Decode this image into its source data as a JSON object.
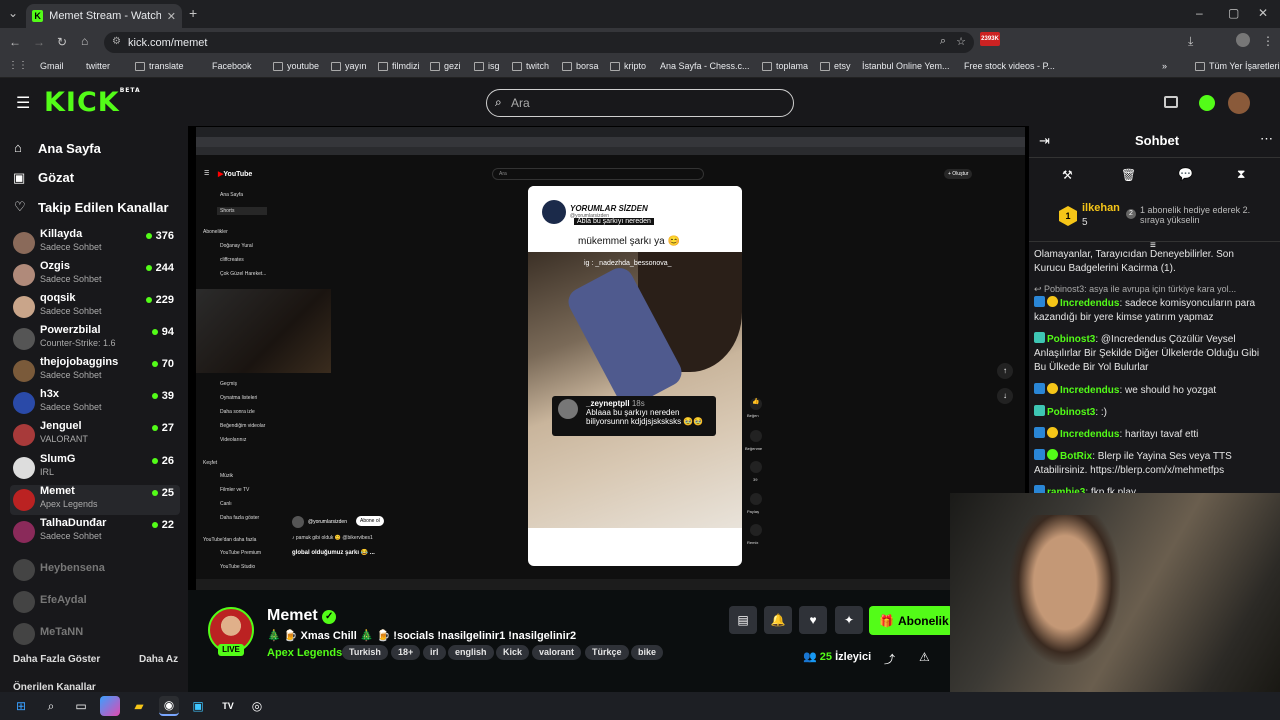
{
  "browser": {
    "tab_title": "Memet Stream - Watch Live on",
    "url": "kick.com/memet",
    "bookmarks": [
      "Gmail",
      "twitter",
      "translate",
      "Facebook",
      "youtube",
      "yayın",
      "filmdizi",
      "gezi",
      "isg",
      "twitch",
      "borsa",
      "kripto",
      "Ana Sayfa - Chess.c...",
      "toplama",
      "etsy",
      "İstanbul Online Yem...",
      "Free stock videos - P...",
      "Tüm Yer İşaretleri"
    ],
    "ext_badge": "2393K"
  },
  "header": {
    "logo": "KICK",
    "logo_sup": "BETA",
    "search_placeholder": "Ara"
  },
  "sidebar": {
    "nav": [
      "Ana Sayfa",
      "Gözat",
      "Takip Edilen Kanallar"
    ],
    "channels": [
      {
        "name": "Killayda",
        "sub": "Sadece Sohbet",
        "viewers": "376",
        "color": "#8a6a5a"
      },
      {
        "name": "Ozgis",
        "sub": "Sadece Sohbet",
        "viewers": "244",
        "color": "#b08a7a"
      },
      {
        "name": "qoqsik",
        "sub": "Sadece Sohbet",
        "viewers": "229",
        "color": "#c9a58a"
      },
      {
        "name": "Powerzbilal",
        "sub": "Counter-Strike: 1.6",
        "viewers": "94",
        "color": "#555"
      },
      {
        "name": "thejojobaggins",
        "sub": "Sadece Sohbet",
        "viewers": "70",
        "color": "#7a5a3a"
      },
      {
        "name": "h3x",
        "sub": "Sadece Sohbet",
        "viewers": "39",
        "color": "#2a4aa8"
      },
      {
        "name": "Jenguel",
        "sub": "VALORANT",
        "viewers": "27",
        "color": "#a83a3a"
      },
      {
        "name": "SlumG",
        "sub": "IRL",
        "viewers": "26",
        "color": "#ddd"
      },
      {
        "name": "Memet",
        "sub": "Apex Legends",
        "viewers": "25",
        "color": "#b22"
      },
      {
        "name": "TalhaDunđar",
        "sub": "Sadece Sohbet",
        "viewers": "22",
        "color": "#8a2a5a"
      }
    ],
    "offline": [
      "Heybensena",
      "EfeAydal",
      "MeTaNN"
    ],
    "show_more": "Daha Fazla Göster",
    "show_less": "Daha Az",
    "recommended": "Önerilen Kanallar"
  },
  "video": {
    "yt_logo": "YouTube",
    "yt_search": "Ara",
    "yt_create": "+ Oluştur",
    "yt_nav": [
      "Ana Sayfa",
      "Shorts",
      "Abonelikler",
      "Doğanay Yural",
      "cliffcreates",
      "Çok Güzel Hareket...",
      "Geçmiş",
      "Oynatma listeleri",
      "Daha sonra izle",
      "Beğendiğim videolar",
      "Videolarınız",
      "Keşfet",
      "Müzik",
      "Filmler ve TV",
      "Canlı",
      "Daha fazla göster",
      "YouTube'dan daha fazla",
      "YouTube Premium",
      "YouTube Studio"
    ],
    "channel": "YORUMLAR SİZDEN",
    "handle": "@yorumlarsizden",
    "overlay_q": "Abla bu şarkıyı nereden",
    "caption": "mükemmel şarkı ya 😊",
    "ig": "ig : _nadezhda_bessonova_",
    "comment_user": "_zeyneptpll",
    "comment_time": "18s",
    "comment_text": "Ablaaa bu şarkıyı nereden biliyorsunnn kdjdjsjsksksks 🥹🥹",
    "sub_channel": "@yorumlarsizden",
    "sub_btn": "Abone ol",
    "song1": "♪ pamuk gibi olduk 😊 @bikervibes1",
    "song2": "global olduğumuz şarkı 😂 ...",
    "actions": [
      "Beğen",
      "Beğenme",
      "39",
      "Paylaş",
      "Remix"
    ]
  },
  "stream": {
    "name": "Memet",
    "title": "🎄 🍺 Xmas Chill 🎄 🍺 !socials !nasilgelinir1 !nasilgelinir2",
    "category": "Apex Legends",
    "tags": [
      "Turkish",
      "18+",
      "irl",
      "english",
      "Kick",
      "valorant",
      "Türkçe",
      "bike"
    ],
    "live": "LIVE",
    "subscribe": "Abonelik Ol",
    "viewers": "25",
    "viewers_label": "İzleyici"
  },
  "chat": {
    "title": "Sohbet",
    "pinned_user": "ilkehan",
    "pinned_count": "5",
    "pinned_rank": "2",
    "pinned_text": "1 abonelik hediye ederek 2. sıraya yükselin",
    "messages": [
      {
        "user": "",
        "color": "#e6e6e6",
        "text": "Olamayanlar, Tarayıcıdan Deneyebilirler. Son Kurucu Badgelerini Kacirma (1)."
      },
      {
        "user": "",
        "color": "#aaa",
        "text": "↩ Pobinost3: asya ile avrupa için türkiye kara yol..."
      },
      {
        "user": "Incredendus",
        "color": "#53fc18",
        "text": "sadece komisyoncuların para kazandığı bir yere kimse yatırım yapmaz"
      },
      {
        "user": "Pobinost3",
        "color": "#53fc18",
        "text": "@Incredendus Çözülür Veysel Anlaşılırlar Bir Şekilde Diğer Ülkelerde Olduğu Gibi Bu Ülkede Bir Yol Bulurlar"
      },
      {
        "user": "Incredendus",
        "color": "#53fc18",
        "text": "we should ho yozgat"
      },
      {
        "user": "Pobinost3",
        "color": "#53fc18",
        "text": ":)"
      },
      {
        "user": "Incredendus",
        "color": "#53fc18",
        "text": "haritayı tavaf etti"
      },
      {
        "user": "BotRix",
        "color": "#53fc18",
        "text": "Blerp ile Yayina Ses veya TTS Atabilirsiniz. https://blerp.com/x/mehmetfps"
      },
      {
        "user": "rambie3",
        "color": "#53fc18",
        "text": "fkp fk play"
      }
    ]
  },
  "colors": {
    "accent": "#53fc18",
    "bg": "#0b0e0f",
    "panel": "#18181b"
  }
}
